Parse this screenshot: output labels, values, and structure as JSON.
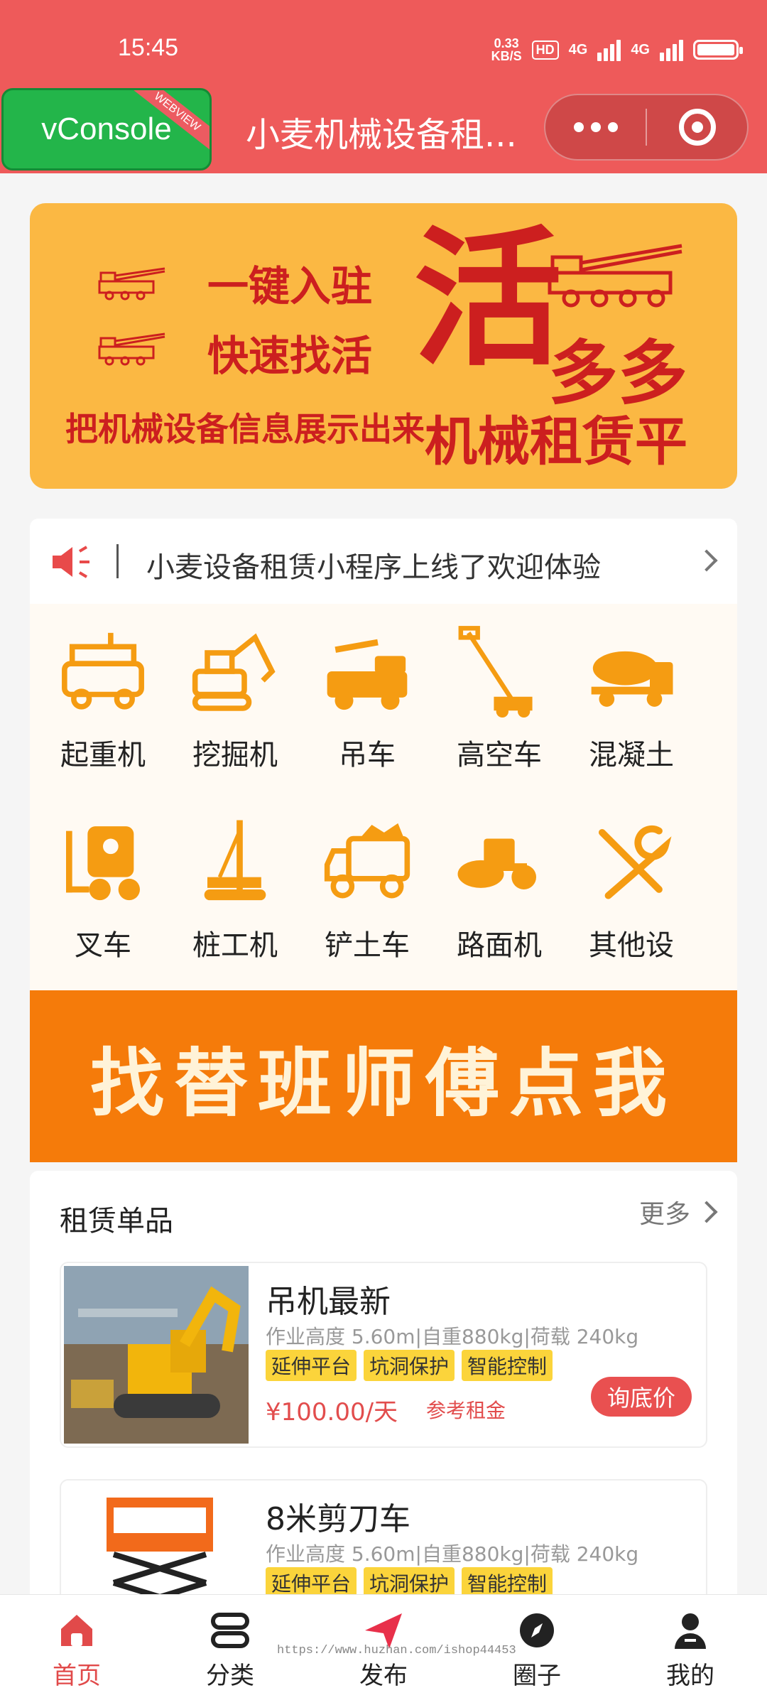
{
  "status_bar": {
    "time": "15:45",
    "net_speed_top": "0.33",
    "net_speed_bottom": "KB/S",
    "hd": "HD",
    "signal_1": "4G",
    "signal_2": "4G"
  },
  "header": {
    "vconsole_label": "vConsole",
    "webview_tag": "WEBVIEW",
    "title": "小麦机械设备租..."
  },
  "banner": {
    "line1": "一键入驻",
    "line2": "快速找活",
    "line3": "把机械设备信息展示出来",
    "big_char": "活",
    "duo": "多多",
    "platform": "机械租赁平台"
  },
  "notice": {
    "text": "小麦设备租赁小程序上线了欢迎体验"
  },
  "categories": [
    {
      "label": "起重机"
    },
    {
      "label": "挖掘机"
    },
    {
      "label": "吊车"
    },
    {
      "label": "高空车"
    },
    {
      "label": "混凝土"
    },
    {
      "label": "叉车"
    },
    {
      "label": "桩工机"
    },
    {
      "label": "铲土车"
    },
    {
      "label": "路面机"
    },
    {
      "label": "其他设"
    }
  ],
  "promo": {
    "text": "找替班师傅点我"
  },
  "rental": {
    "title": "租赁单品",
    "more": "更多",
    "items": [
      {
        "name": "吊机最新",
        "spec": "作业高度 5.60m|自重880kg|荷载 240kg",
        "tags": [
          "延伸平台",
          "坑洞保护",
          "智能控制"
        ],
        "price": "¥100.00/天",
        "price_note": "参考租金",
        "button": "询底价"
      },
      {
        "name": "8米剪刀车",
        "spec": "作业高度 5.60m|自重880kg|荷载 240kg",
        "tags": [
          "延伸平台",
          "坑洞保护",
          "智能控制"
        ]
      }
    ]
  },
  "tabbar": [
    {
      "label": "首页",
      "icon": "home-icon",
      "active": true
    },
    {
      "label": "分类",
      "icon": "category-icon"
    },
    {
      "label": "发布",
      "icon": "publish-icon"
    },
    {
      "label": "圈子",
      "icon": "compass-icon"
    },
    {
      "label": "我的",
      "icon": "user-icon"
    }
  ],
  "watermark": "https://www.huzhan.com/ishop44453",
  "colors": {
    "header": "#ee5a5a",
    "banner_bg": "#fbb843",
    "banner_text": "#cc1f1f",
    "icon_orange": "#f59c12",
    "promo_bg": "#f57b0a",
    "tag_bg": "#fbd43b",
    "price": "#e24d4d",
    "active_tab": "#e14a4a"
  }
}
